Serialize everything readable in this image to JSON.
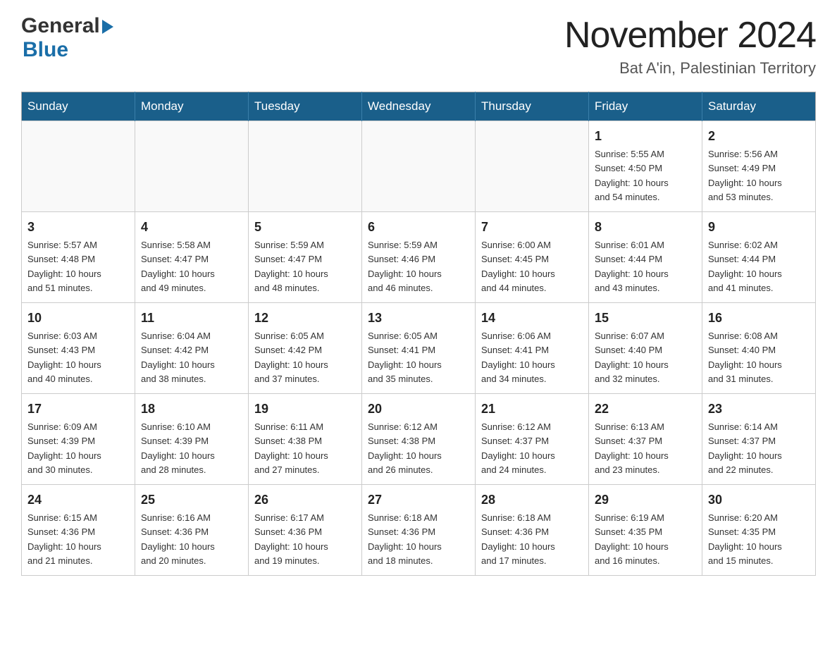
{
  "header": {
    "month_title": "November 2024",
    "location": "Bat A'in, Palestinian Territory"
  },
  "logo": {
    "general": "General",
    "blue": "Blue"
  },
  "weekdays": [
    "Sunday",
    "Monday",
    "Tuesday",
    "Wednesday",
    "Thursday",
    "Friday",
    "Saturday"
  ],
  "weeks": [
    [
      {
        "day": "",
        "info": ""
      },
      {
        "day": "",
        "info": ""
      },
      {
        "day": "",
        "info": ""
      },
      {
        "day": "",
        "info": ""
      },
      {
        "day": "",
        "info": ""
      },
      {
        "day": "1",
        "info": "Sunrise: 5:55 AM\nSunset: 4:50 PM\nDaylight: 10 hours\nand 54 minutes."
      },
      {
        "day": "2",
        "info": "Sunrise: 5:56 AM\nSunset: 4:49 PM\nDaylight: 10 hours\nand 53 minutes."
      }
    ],
    [
      {
        "day": "3",
        "info": "Sunrise: 5:57 AM\nSunset: 4:48 PM\nDaylight: 10 hours\nand 51 minutes."
      },
      {
        "day": "4",
        "info": "Sunrise: 5:58 AM\nSunset: 4:47 PM\nDaylight: 10 hours\nand 49 minutes."
      },
      {
        "day": "5",
        "info": "Sunrise: 5:59 AM\nSunset: 4:47 PM\nDaylight: 10 hours\nand 48 minutes."
      },
      {
        "day": "6",
        "info": "Sunrise: 5:59 AM\nSunset: 4:46 PM\nDaylight: 10 hours\nand 46 minutes."
      },
      {
        "day": "7",
        "info": "Sunrise: 6:00 AM\nSunset: 4:45 PM\nDaylight: 10 hours\nand 44 minutes."
      },
      {
        "day": "8",
        "info": "Sunrise: 6:01 AM\nSunset: 4:44 PM\nDaylight: 10 hours\nand 43 minutes."
      },
      {
        "day": "9",
        "info": "Sunrise: 6:02 AM\nSunset: 4:44 PM\nDaylight: 10 hours\nand 41 minutes."
      }
    ],
    [
      {
        "day": "10",
        "info": "Sunrise: 6:03 AM\nSunset: 4:43 PM\nDaylight: 10 hours\nand 40 minutes."
      },
      {
        "day": "11",
        "info": "Sunrise: 6:04 AM\nSunset: 4:42 PM\nDaylight: 10 hours\nand 38 minutes."
      },
      {
        "day": "12",
        "info": "Sunrise: 6:05 AM\nSunset: 4:42 PM\nDaylight: 10 hours\nand 37 minutes."
      },
      {
        "day": "13",
        "info": "Sunrise: 6:05 AM\nSunset: 4:41 PM\nDaylight: 10 hours\nand 35 minutes."
      },
      {
        "day": "14",
        "info": "Sunrise: 6:06 AM\nSunset: 4:41 PM\nDaylight: 10 hours\nand 34 minutes."
      },
      {
        "day": "15",
        "info": "Sunrise: 6:07 AM\nSunset: 4:40 PM\nDaylight: 10 hours\nand 32 minutes."
      },
      {
        "day": "16",
        "info": "Sunrise: 6:08 AM\nSunset: 4:40 PM\nDaylight: 10 hours\nand 31 minutes."
      }
    ],
    [
      {
        "day": "17",
        "info": "Sunrise: 6:09 AM\nSunset: 4:39 PM\nDaylight: 10 hours\nand 30 minutes."
      },
      {
        "day": "18",
        "info": "Sunrise: 6:10 AM\nSunset: 4:39 PM\nDaylight: 10 hours\nand 28 minutes."
      },
      {
        "day": "19",
        "info": "Sunrise: 6:11 AM\nSunset: 4:38 PM\nDaylight: 10 hours\nand 27 minutes."
      },
      {
        "day": "20",
        "info": "Sunrise: 6:12 AM\nSunset: 4:38 PM\nDaylight: 10 hours\nand 26 minutes."
      },
      {
        "day": "21",
        "info": "Sunrise: 6:12 AM\nSunset: 4:37 PM\nDaylight: 10 hours\nand 24 minutes."
      },
      {
        "day": "22",
        "info": "Sunrise: 6:13 AM\nSunset: 4:37 PM\nDaylight: 10 hours\nand 23 minutes."
      },
      {
        "day": "23",
        "info": "Sunrise: 6:14 AM\nSunset: 4:37 PM\nDaylight: 10 hours\nand 22 minutes."
      }
    ],
    [
      {
        "day": "24",
        "info": "Sunrise: 6:15 AM\nSunset: 4:36 PM\nDaylight: 10 hours\nand 21 minutes."
      },
      {
        "day": "25",
        "info": "Sunrise: 6:16 AM\nSunset: 4:36 PM\nDaylight: 10 hours\nand 20 minutes."
      },
      {
        "day": "26",
        "info": "Sunrise: 6:17 AM\nSunset: 4:36 PM\nDaylight: 10 hours\nand 19 minutes."
      },
      {
        "day": "27",
        "info": "Sunrise: 6:18 AM\nSunset: 4:36 PM\nDaylight: 10 hours\nand 18 minutes."
      },
      {
        "day": "28",
        "info": "Sunrise: 6:18 AM\nSunset: 4:36 PM\nDaylight: 10 hours\nand 17 minutes."
      },
      {
        "day": "29",
        "info": "Sunrise: 6:19 AM\nSunset: 4:35 PM\nDaylight: 10 hours\nand 16 minutes."
      },
      {
        "day": "30",
        "info": "Sunrise: 6:20 AM\nSunset: 4:35 PM\nDaylight: 10 hours\nand 15 minutes."
      }
    ]
  ]
}
